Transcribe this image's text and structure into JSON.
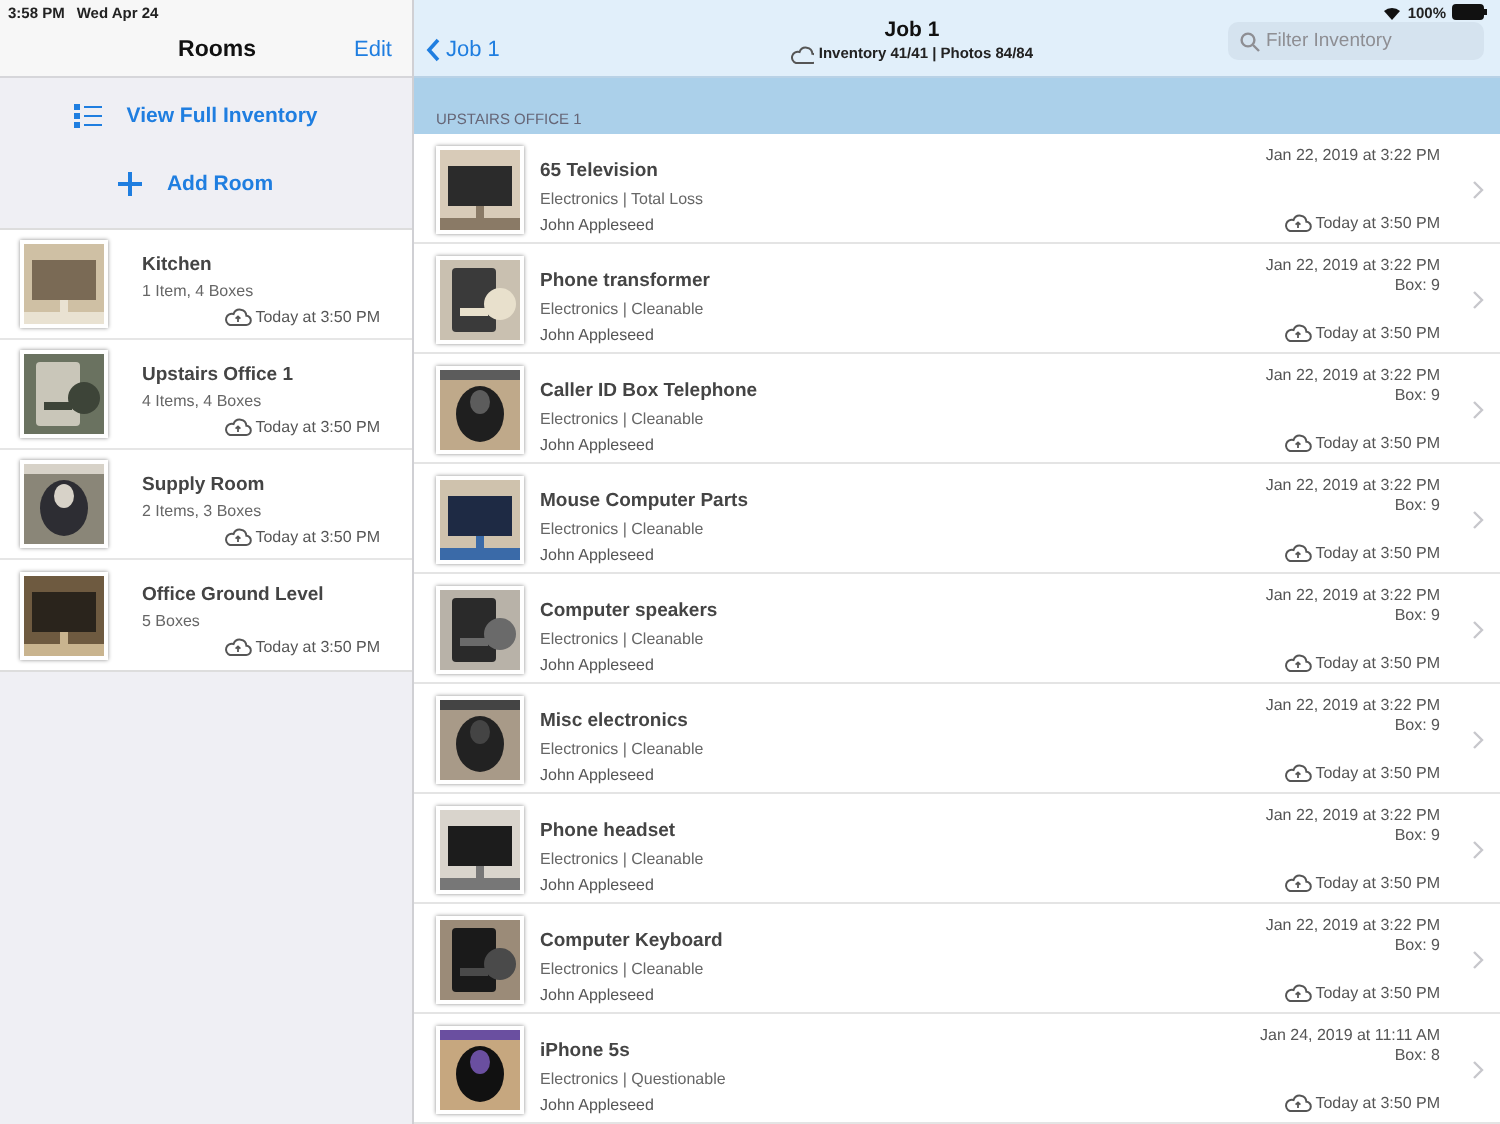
{
  "status_bar": {
    "time": "3:58 PM",
    "date": "Wed Apr 24",
    "battery_text": "100%"
  },
  "sidebar": {
    "title": "Rooms",
    "edit": "Edit",
    "actions": [
      {
        "kind": "list",
        "label": "View Full Inventory"
      },
      {
        "kind": "add",
        "label": "Add Room"
      }
    ],
    "rooms": [
      {
        "name": "Kitchen",
        "summary": "1 Item, 4 Boxes",
        "synced": "Today at 3:50 PM"
      },
      {
        "name": "Upstairs Office 1",
        "summary": "4 Items, 4 Boxes",
        "synced": "Today at 3:50 PM"
      },
      {
        "name": "Supply Room",
        "summary": "2 Items, 3 Boxes",
        "synced": "Today at 3:50 PM"
      },
      {
        "name": "Office Ground Level",
        "summary": "5 Boxes",
        "synced": "Today at 3:50 PM"
      }
    ]
  },
  "header": {
    "back": "Job 1",
    "title": "Job 1",
    "subtitle": "Inventory 41/41 | Photos 84/84",
    "search": {
      "placeholder": "Filter Inventory"
    }
  },
  "section": "UPSTAIRS OFFICE 1",
  "items": [
    {
      "name": "65 Television",
      "category": "Electronics | Total Loss",
      "owner": "John Appleseed",
      "date": "Jan 22, 2019 at 3:22 PM",
      "synced": "Today at 3:50 PM"
    },
    {
      "name": "Phone transformer",
      "category": "Electronics | Cleanable",
      "owner": "John Appleseed",
      "date": "Jan 22, 2019 at 3:22 PM",
      "box": "Box: 9",
      "synced": "Today at 3:50 PM"
    },
    {
      "name": "Caller ID Box Telephone",
      "category": "Electronics | Cleanable",
      "owner": "John Appleseed",
      "date": "Jan 22, 2019 at 3:22 PM",
      "box": "Box: 9",
      "synced": "Today at 3:50 PM"
    },
    {
      "name": "Mouse Computer Parts",
      "category": "Electronics | Cleanable",
      "owner": "John Appleseed",
      "date": "Jan 22, 2019 at 3:22 PM",
      "box": "Box: 9",
      "synced": "Today at 3:50 PM"
    },
    {
      "name": "Computer speakers",
      "category": "Electronics | Cleanable",
      "owner": "John Appleseed",
      "date": "Jan 22, 2019 at 3:22 PM",
      "box": "Box: 9",
      "synced": "Today at 3:50 PM"
    },
    {
      "name": "Misc electronics",
      "category": "Electronics | Cleanable",
      "owner": "John Appleseed",
      "date": "Jan 22, 2019 at 3:22 PM",
      "box": "Box: 9",
      "synced": "Today at 3:50 PM"
    },
    {
      "name": "Phone headset",
      "category": "Electronics | Cleanable",
      "owner": "John Appleseed",
      "date": "Jan 22, 2019 at 3:22 PM",
      "box": "Box: 9",
      "synced": "Today at 3:50 PM"
    },
    {
      "name": "Computer Keyboard",
      "category": "Electronics | Cleanable",
      "owner": "John Appleseed",
      "date": "Jan 22, 2019 at 3:22 PM",
      "box": "Box: 9",
      "synced": "Today at 3:50 PM"
    },
    {
      "name": "iPhone 5s",
      "category": "Electronics | Questionable",
      "owner": "John Appleseed",
      "date": "Jan 24, 2019 at 11:11 AM",
      "box": "Box: 8",
      "synced": "Today at 3:50 PM"
    }
  ]
}
